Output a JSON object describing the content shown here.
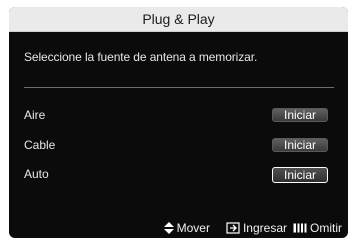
{
  "dialog": {
    "title": "Plug & Play",
    "instruction": "Seleccione la fuente de antena a memorizar."
  },
  "options": [
    {
      "label": "Aire",
      "button": "Iniciar",
      "selected": false
    },
    {
      "label": "Cable",
      "button": "Iniciar",
      "selected": false
    },
    {
      "label": "Auto",
      "button": "Iniciar",
      "selected": true
    }
  ],
  "footer": {
    "move": "Mover",
    "enter": "Ingresar",
    "skip": "Omitir"
  }
}
